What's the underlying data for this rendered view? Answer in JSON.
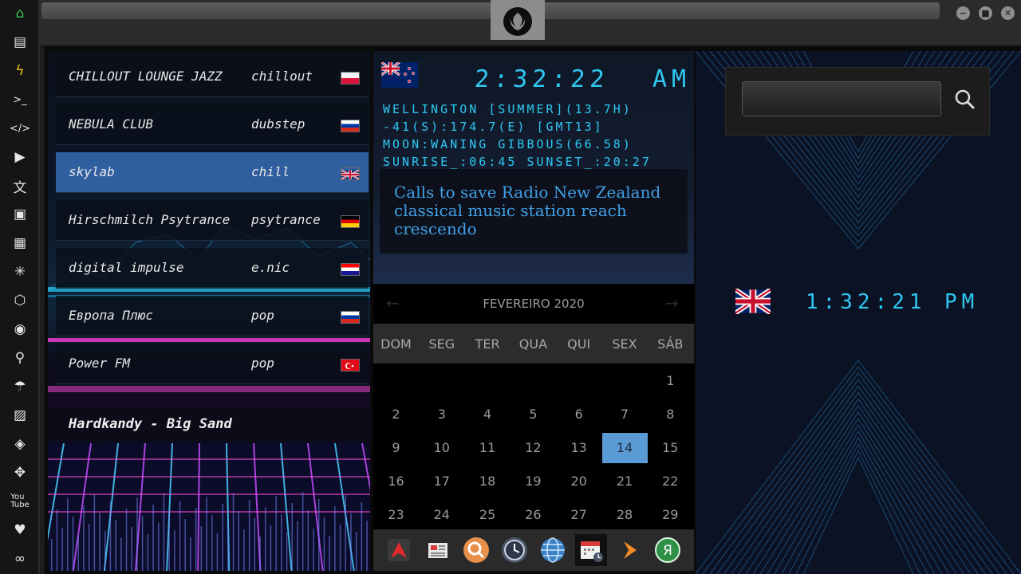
{
  "window": {
    "controls": {
      "minimize": "−",
      "maximize": "■",
      "close": "✕"
    }
  },
  "sidebar": {
    "icons": [
      "home-icon",
      "document-icon",
      "bolt-icon",
      "terminal-icon",
      "code-icon",
      "play-icon",
      "translate-icon",
      "image-icon",
      "news-icon",
      "asterisk-icon",
      "hexagon-icon",
      "globe-icon",
      "search-icon",
      "umbrella-icon",
      "contact-icon",
      "diamond-link-icon",
      "shuffle-icon",
      "youtube-icon",
      "heart-icon",
      "infinity-icon"
    ]
  },
  "radio": {
    "stations": [
      {
        "name": "CHILLOUT LOUNGE JAZZ",
        "genre": "chillout",
        "flag": "poland"
      },
      {
        "name": "NEBULA CLUB",
        "genre": "dubstep",
        "flag": "russia"
      },
      {
        "name": "skylab",
        "genre": "chill",
        "flag": "uk",
        "active": true
      },
      {
        "name": "Hirschmilch Psytrance",
        "genre": "psytrance",
        "flag": "germany"
      },
      {
        "name": "digital impulse",
        "genre": "e.nic",
        "flag": "croatia"
      },
      {
        "name": "Европа Плюс",
        "genre": "pop",
        "flag": "russia"
      },
      {
        "name": "Power FM",
        "genre": "pop",
        "flag": "turkey"
      }
    ],
    "now_playing": "Hardkandy - Big Sand"
  },
  "world_clock": {
    "flag": "new-zealand",
    "time": "2:32:22",
    "ampm": "AM",
    "location": "WELLINGTON [SUMMER](13.7H)",
    "coords": "-41(S):174.7(E) [GMT13]",
    "moon": "MOON:WANING GIBBOUS(66.58)",
    "sun": "SUNRISE_:06:45 SUNSET_:20:27",
    "news": "Calls to save Radio New Zealand classical music station reach crescendo"
  },
  "calendar": {
    "month": "FEVEREIRO 2020",
    "prev": "←",
    "next": "→",
    "weekdays": [
      "DOM",
      "SEG",
      "TER",
      "QUA",
      "QUI",
      "SEX",
      "SÁB"
    ],
    "weeks": [
      [
        "",
        "",
        "",
        "",
        "",
        "",
        "1"
      ],
      [
        "2",
        "3",
        "4",
        "5",
        "6",
        "7",
        "8"
      ],
      [
        "9",
        "10",
        "11",
        "12",
        "13",
        "14",
        "15"
      ],
      [
        "16",
        "17",
        "18",
        "19",
        "20",
        "21",
        "22"
      ],
      [
        "23",
        "24",
        "25",
        "26",
        "27",
        "28",
        "29"
      ]
    ],
    "today": "14"
  },
  "dock": {
    "items": [
      "app-launcher-icon",
      "newspaper-icon",
      "search-app-icon",
      "clock-app-icon",
      "web-browser-icon",
      "calendar-app-icon",
      "play-app-icon",
      "yandex-icon"
    ],
    "selected": "calendar-app-icon"
  },
  "local_clock": {
    "flag": "uk",
    "time": "1:32:21",
    "ampm": "PM"
  },
  "search": {
    "placeholder": "",
    "value": ""
  },
  "colors": {
    "digital": "#2ec8f2",
    "accent": "#5b9bd5",
    "news": "#3fa0e6",
    "active_station": "#3c78c8"
  }
}
